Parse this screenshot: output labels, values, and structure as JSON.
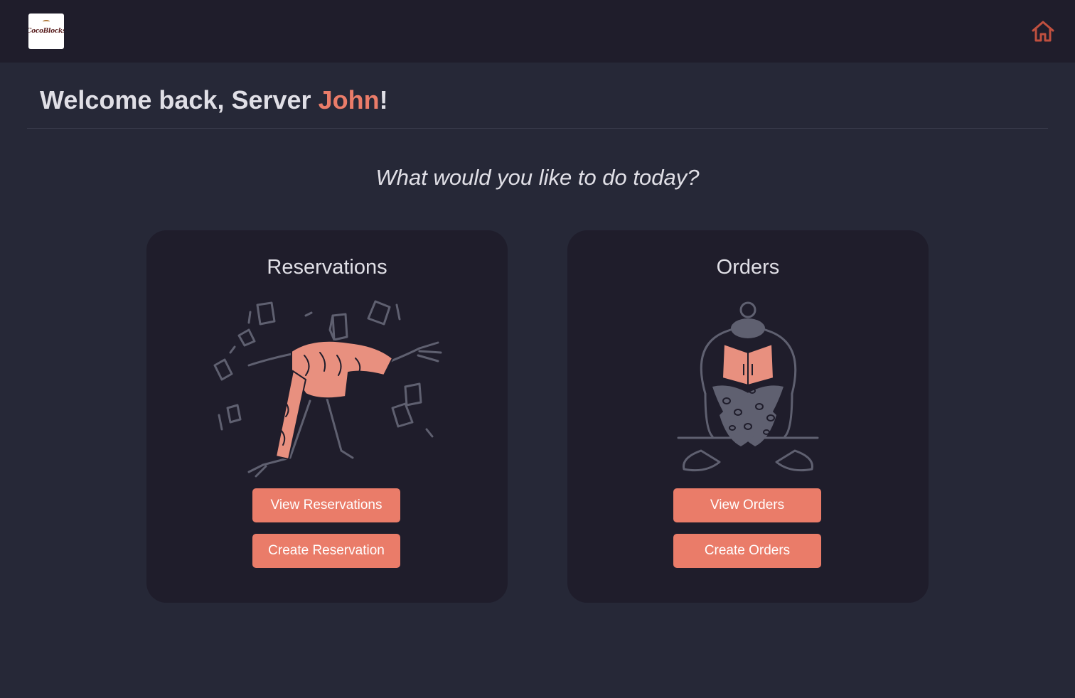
{
  "header": {
    "logo_text": "CocoBlocks",
    "home_icon": "home-icon"
  },
  "welcome": {
    "prefix": "Welcome back, Server ",
    "name": "John",
    "suffix": "!"
  },
  "prompt": "What would you like to do today?",
  "cards": {
    "reservations": {
      "title": "Reservations",
      "view_label": "View Reservations",
      "create_label": "Create Reservation"
    },
    "orders": {
      "title": "Orders",
      "view_label": "View Orders",
      "create_label": "Create Orders"
    }
  },
  "colors": {
    "accent": "#ea7c69",
    "background": "#262837",
    "surface": "#1f1d2b",
    "text": "#e0dfe6",
    "illustration_stroke": "#5f6070"
  }
}
